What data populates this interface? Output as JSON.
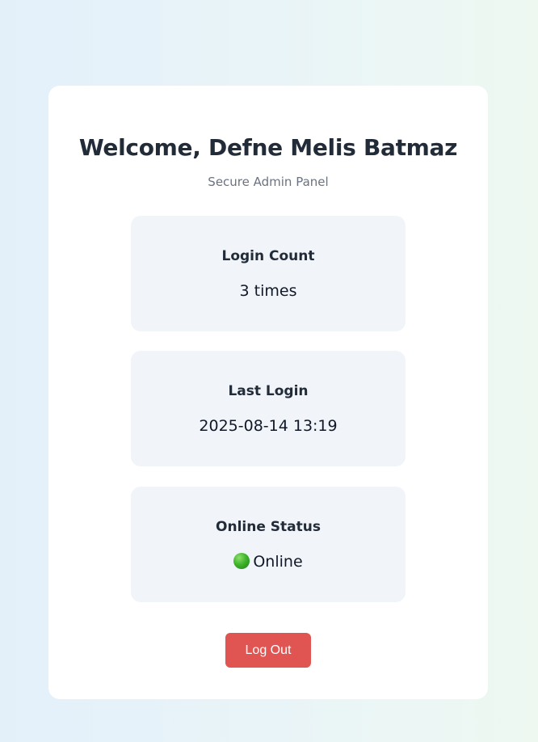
{
  "header": {
    "title": "Welcome, Defne Melis Batmaz",
    "subtitle": "Secure Admin Panel"
  },
  "stats": {
    "login_count": {
      "label": "Login Count",
      "value": "3 times"
    },
    "last_login": {
      "label": "Last Login",
      "value": "2025-08-14 13:19"
    },
    "online_status": {
      "label": "Online Status",
      "value": "Online",
      "icon": "green-circle-icon",
      "color": "#3fb52b"
    }
  },
  "actions": {
    "logout_label": "Log Out",
    "logout_color": "#e05552"
  }
}
